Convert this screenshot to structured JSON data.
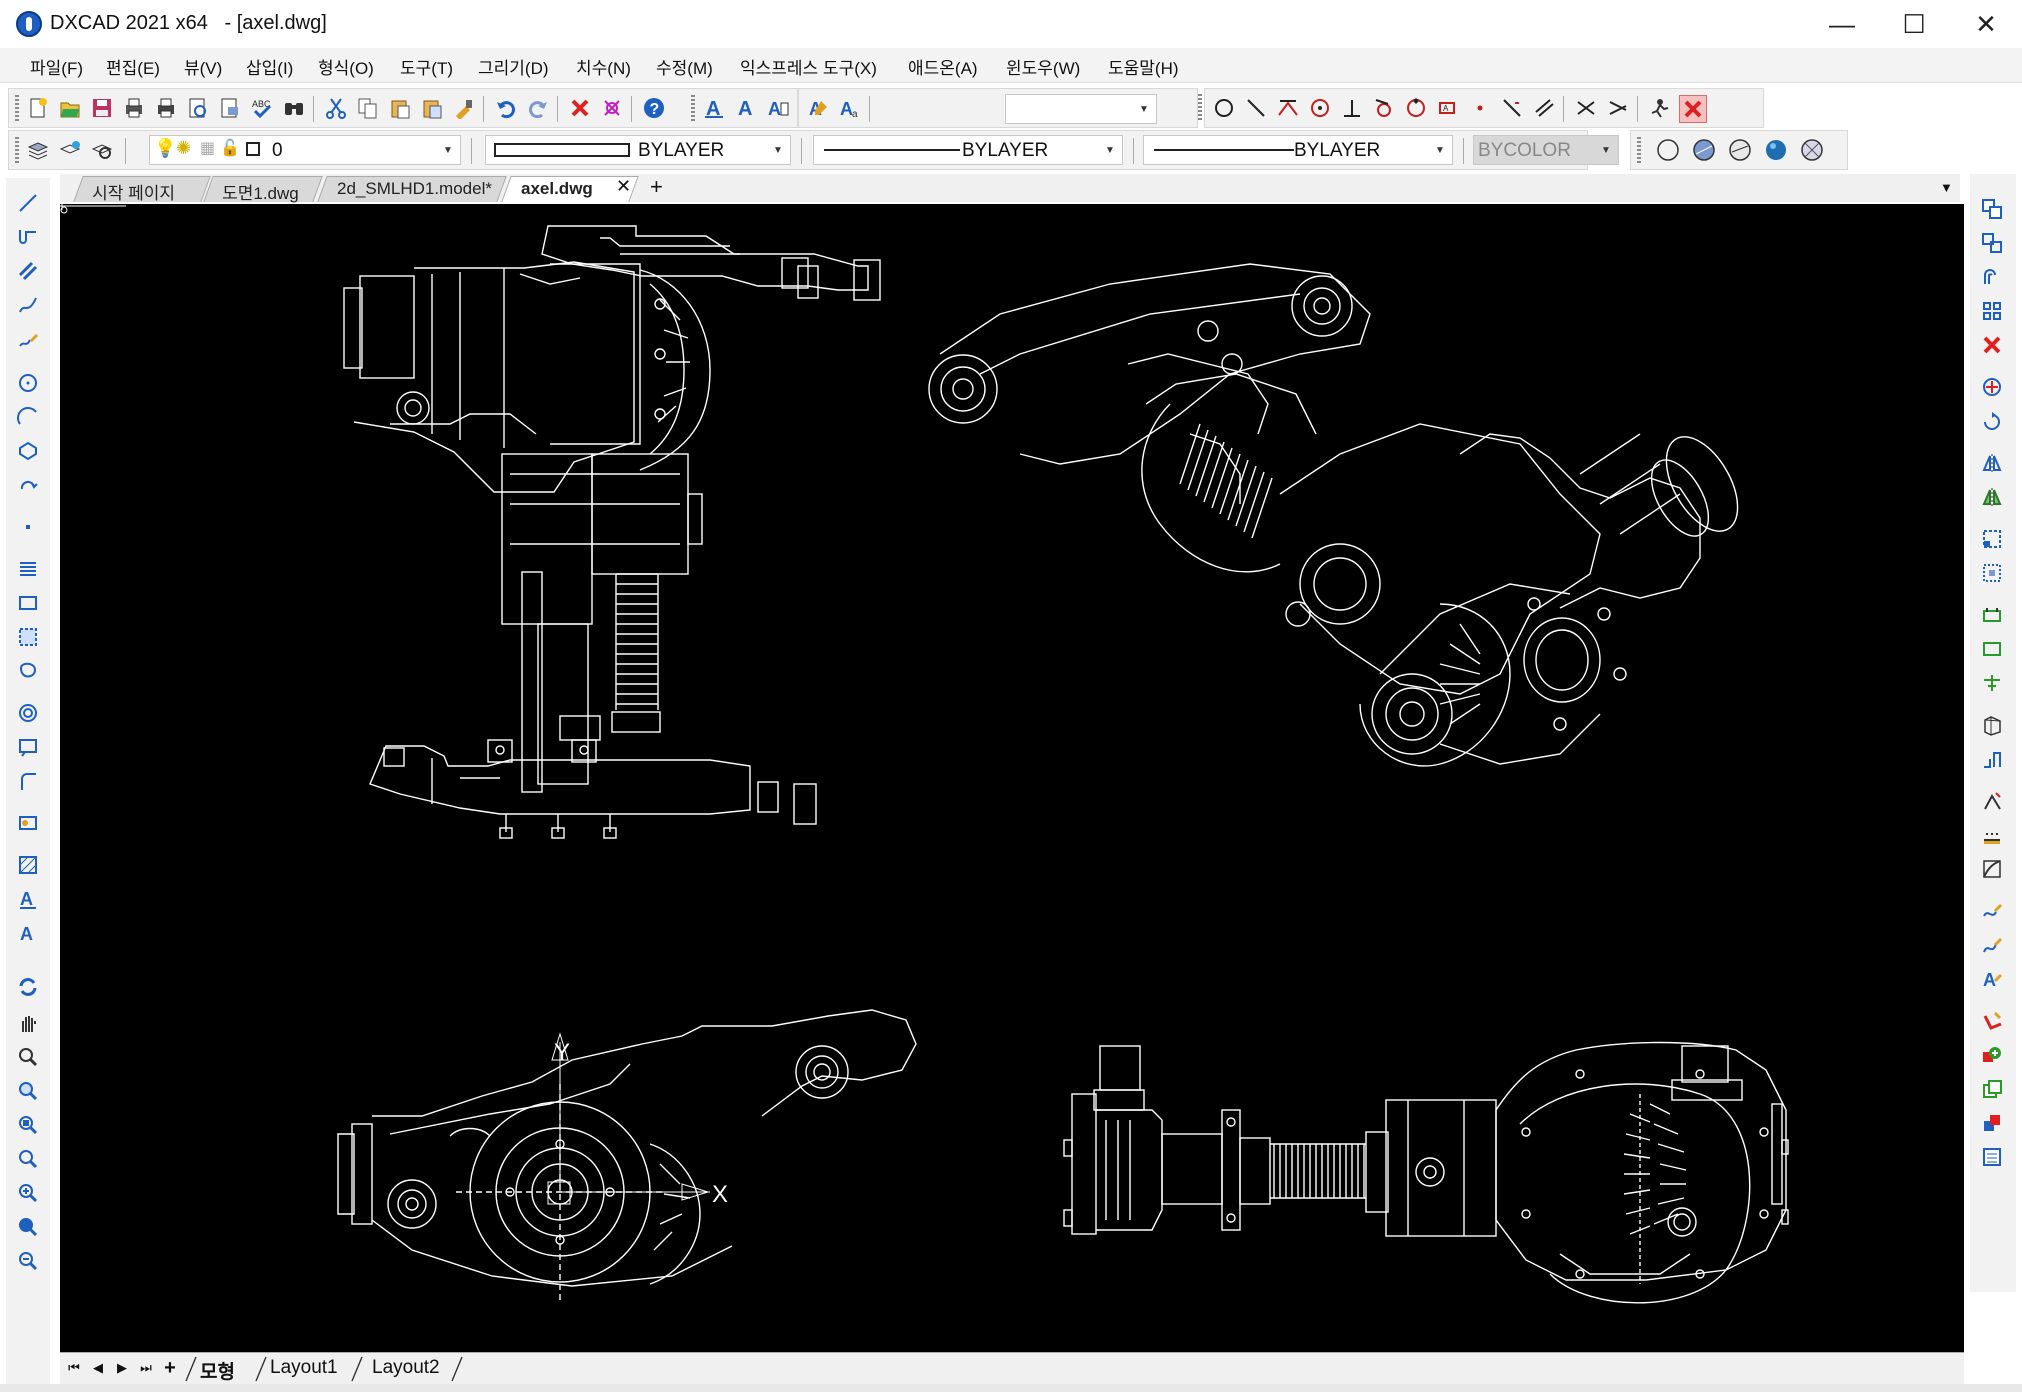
{
  "window": {
    "title": "DXCAD 2021 x64   - [axel.dwg]",
    "minimize": "—",
    "maximize": "☐",
    "close": "✕"
  },
  "menu": [
    "파일(F)",
    "편집(E)",
    "뷰(V)",
    "삽입(I)",
    "형식(O)",
    "도구(T)",
    "그리기(D)",
    "치수(N)",
    "수정(M)",
    "익스프레스 도구(X)",
    "애드온(A)",
    "윈도우(W)",
    "도움말(H)"
  ],
  "properties_toolbar": {
    "layer": "0",
    "color": "BYLAYER",
    "linetype": "BYLAYER",
    "lineweight": "BYLAYER",
    "plotstyle": "BYCOLOR"
  },
  "tabs": [
    "시작 페이지",
    "도면1.dwg",
    "2d_SMLHD1.model*",
    "axel.dwg"
  ],
  "tab_close": "✕",
  "tab_add": "+",
  "canvas": {
    "axis_y": "Y",
    "axis_x": "X"
  },
  "layout_tabs": [
    "모형",
    "Layout1",
    "Layout2"
  ],
  "colors": {
    "canvas_bg": "#000000",
    "drawing_lines": "#ffffff",
    "accent_blue": "#1f5fbf",
    "delete_red": "#e02020"
  }
}
